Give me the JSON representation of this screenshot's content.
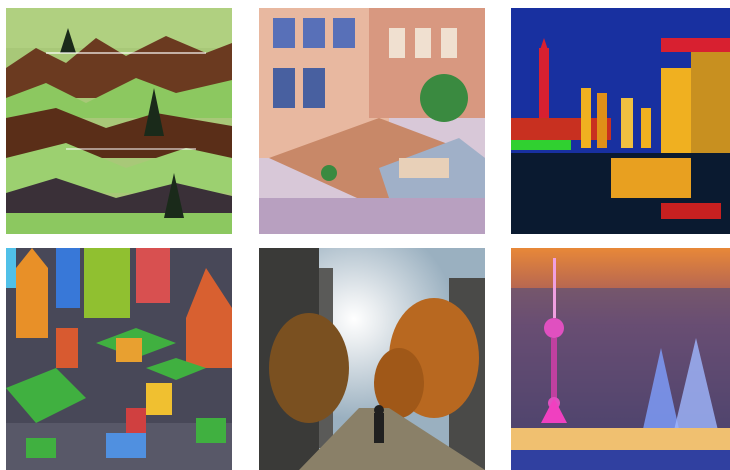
{
  "gallery": {
    "tiles": [
      {
        "subject": "pixel-art-forest-hills",
        "colors": {
          "sky": "#a8c878",
          "ground": "#6b3a20",
          "grass": "#8cc860"
        }
      },
      {
        "subject": "isometric-pixel-building-courtyard",
        "colors": {
          "wall": "#e8b8a0",
          "window": "#5870b8",
          "deck": "#c88868"
        }
      },
      {
        "subject": "pixel-art-city-skyline-blue-sky",
        "colors": {
          "sky": "#1830a0",
          "building": "#f0b020",
          "tower": "#d82030"
        }
      },
      {
        "subject": "isometric-pixel-city-blocks",
        "colors": {
          "road": "#484858",
          "park": "#40b040",
          "tower": "#e89028"
        }
      },
      {
        "subject": "photo-city-street-sunlight-walker",
        "colors": {
          "sky": "#b8c8d0",
          "tree": "#b86820",
          "street": "#8a8068"
        }
      },
      {
        "subject": "pixel-art-tv-tower-night-rain",
        "colors": {
          "sky": "#3a2858",
          "tower": "#e050c0",
          "lights": "#80a0ff"
        }
      }
    ]
  }
}
